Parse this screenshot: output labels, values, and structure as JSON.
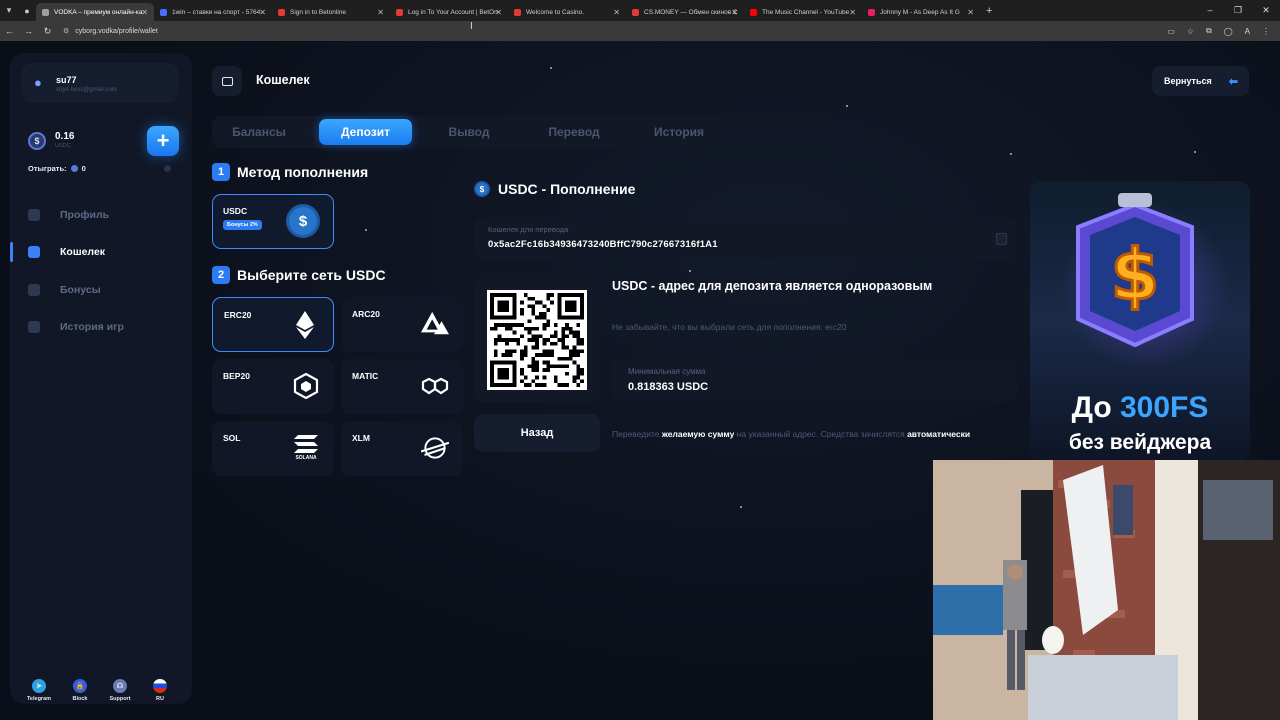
{
  "browser": {
    "tabs": [
      {
        "title": "VODKA – премиум онлайн-ка",
        "color": "#9aa0a6",
        "active": true
      },
      {
        "title": "1win – ставки на спорт - 5764",
        "color": "#4b6cff",
        "active": false
      },
      {
        "title": "Sign in to Betonline",
        "color": "#e53935",
        "active": false
      },
      {
        "title": "Log in To Your Account | BetOn",
        "color": "#e53935",
        "active": false
      },
      {
        "title": "Welcome to Casino.",
        "color": "#e53935",
        "active": false
      },
      {
        "title": "CS.MONEY — Обмен скинов С",
        "color": "#e53935",
        "active": false
      },
      {
        "title": "The Music Channel - YouTube",
        "color": "#ff0000",
        "active": false
      },
      {
        "title": "Johnny M - As Deep As It G",
        "color": "#e91e63",
        "active": false
      }
    ],
    "url": "cyborg.vodka/profile/wallet"
  },
  "sidebar": {
    "username": "su77",
    "email": "stry4.boss@gmail.com",
    "balance": "0.16",
    "currency": "USDC",
    "wager_label": "Отыграть:",
    "wager_value": "0",
    "nav": [
      {
        "label": "Профиль",
        "active": false
      },
      {
        "label": "Кошелек",
        "active": true
      },
      {
        "label": "Бонусы",
        "active": false
      },
      {
        "label": "История игр",
        "active": false
      }
    ],
    "bottom_links": [
      {
        "label": "Telegram",
        "color": "#2aa3e0"
      },
      {
        "label": "Block",
        "color": "#3b5bdb"
      },
      {
        "label": "Support",
        "color": "#6b7ab0"
      },
      {
        "label": "RU",
        "color": "#d33"
      }
    ]
  },
  "header": {
    "title": "Кошелек",
    "back_label": "Вернуться"
  },
  "tabs": [
    {
      "label": "Балансы",
      "active": false
    },
    {
      "label": "Депозит",
      "active": true
    },
    {
      "label": "Вывод",
      "active": false
    },
    {
      "label": "Перевод",
      "active": false
    },
    {
      "label": "История",
      "active": false
    }
  ],
  "method": {
    "step_num": "1",
    "step_title": "Метод пополнения",
    "card_name": "USDC",
    "card_bonus": "Бонусы 2%"
  },
  "network": {
    "step_num": "2",
    "step_title": "Выберите сеть USDC",
    "items": [
      {
        "name": "ERC20",
        "icon": "ethereum-icon",
        "selected": true
      },
      {
        "name": "ARC20",
        "icon": "avalanche-icon",
        "selected": false
      },
      {
        "name": "BEP20",
        "icon": "bnb-icon",
        "selected": false
      },
      {
        "name": "MATIC",
        "icon": "polygon-icon",
        "selected": false
      },
      {
        "name": "SOL",
        "icon": "solana-icon",
        "selected": false
      },
      {
        "name": "XLM",
        "icon": "stellar-icon",
        "selected": false
      }
    ],
    "solana_caption": "SOLANA"
  },
  "deposit": {
    "title": "USDC - Пополнение",
    "address_label": "Кошелек для перевода",
    "address": "0x5ac2Fc16b34936473240BffC790c27667316f1A1",
    "one_time_notice": "USDC - адрес для депозита является одноразовым",
    "remember_network": "Не забывайте, что вы выбрали сеть для пополнения: erc20",
    "min_label": "Минимальная сумма",
    "min_value": "0.818363 USDC",
    "back_button": "Назад",
    "note_part1": "Переведите ",
    "note_bold1": "желаемую сумму",
    "note_part2": " на указанный адрес. Средства зачислятся ",
    "note_bold2": "автоматически"
  },
  "promo": {
    "line1_prefix": "До ",
    "line1_highlight": "300FS",
    "line2": "без вейджера"
  }
}
